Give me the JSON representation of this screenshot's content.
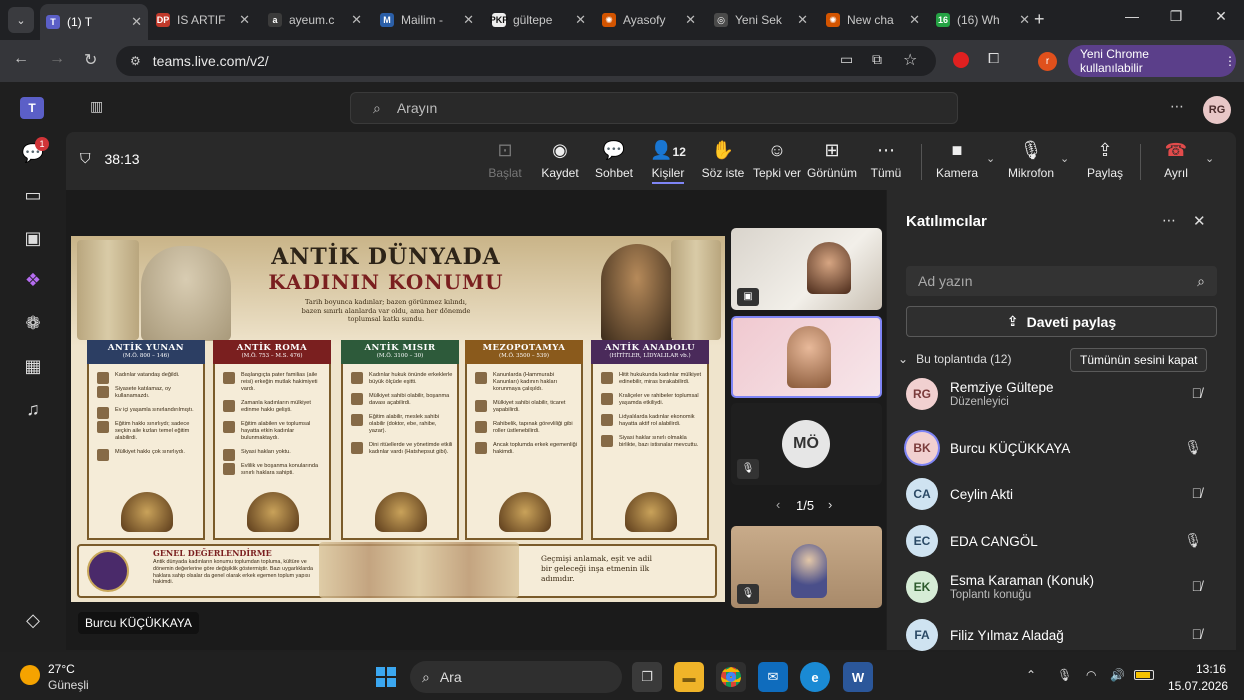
{
  "browser": {
    "tabs": [
      {
        "label": "(1) T",
        "color": "#5b5fc7",
        "glyph": "T"
      },
      {
        "label": "IS ARTIF",
        "color": "#c0392b",
        "glyph": "DP"
      },
      {
        "label": "ayeum.c",
        "color": "#3b3b3b",
        "glyph": "a"
      },
      {
        "label": "Mailim -",
        "color": "#2b5fa8",
        "glyph": "M"
      },
      {
        "label": "gültepe",
        "color": "#eeeeee",
        "glyph": "PKP"
      },
      {
        "label": "Ayasofy",
        "color": "#d35400",
        "glyph": "✺"
      },
      {
        "label": "Yeni Sek",
        "color": "#4a4a4a",
        "glyph": "◎"
      },
      {
        "label": "New cha",
        "color": "#d35400",
        "glyph": "✺"
      },
      {
        "label": "(16) Wh",
        "color": "#25a244",
        "glyph": "16"
      }
    ],
    "url": "teams.live.com/v2/",
    "profile_letter": "r",
    "profile_button": "Yeni Chrome kullanılabilir"
  },
  "teams": {
    "search_placeholder": "Arayın",
    "avatar": "RG",
    "chat_badge": "1",
    "timer": "38:13",
    "toolbar": {
      "start": "Başlat",
      "record": "Kaydet",
      "chat": "Sohbet",
      "people": "Kişiler",
      "people_count": "12",
      "raise": "Söz iste",
      "react": "Tepki ver",
      "view": "Görünüm",
      "more": "Tümü",
      "camera": "Kamera",
      "mic": "Mikrofon",
      "share": "Paylaş",
      "leave": "Ayrıl"
    },
    "presenter_label": "Burcu KÜÇÜKKAYA",
    "video": {
      "mo_initials": "MÖ",
      "pager": "1/5"
    },
    "participants": {
      "title": "Katılımcılar",
      "search_placeholder": "Ad yazın",
      "invite": "Daveti paylaş",
      "section": "Bu toplantıda (12)",
      "mute_all": "Tümünün sesini kapat",
      "people": [
        {
          "initials": "RG",
          "name": "Remziye Gültepe",
          "sub": "Düzenleyici",
          "bg": "#f1d0d0",
          "fg": "#7a3b3b",
          "mic": "muted"
        },
        {
          "initials": "BK",
          "name": "Burcu KÜÇÜKKAYA",
          "sub": "",
          "bg": "#f1d0d0",
          "fg": "#7a3b3b",
          "mic": "on"
        },
        {
          "initials": "CA",
          "name": "Ceylin Akti",
          "sub": "",
          "bg": "#cfe3f1",
          "fg": "#2b4a66",
          "mic": "muted"
        },
        {
          "initials": "EC",
          "name": "EDA CANGÖL",
          "sub": "",
          "bg": "#cfe3f1",
          "fg": "#2b4a66",
          "mic": "on"
        },
        {
          "initials": "EK",
          "name": "Esma Karaman (Konuk)",
          "sub": "Toplantı konuğu",
          "bg": "#d6ecd6",
          "fg": "#2d5a2d",
          "mic": "muted"
        },
        {
          "initials": "FA",
          "name": "Filiz Yılmaz Aladağ",
          "sub": "",
          "bg": "#cfe3f1",
          "fg": "#2b4a66",
          "mic": "muted"
        }
      ]
    }
  },
  "slide": {
    "title1": "ANTİK DÜNYADA",
    "title2": "KADININ KONUMU",
    "subtitle": "Tarih boyunca kadınlar; bazen görünmez kılındı, bazen sınırlı alanlarda var oldu, ama her dönemde toplumsal katkı sundu.",
    "columns": [
      {
        "title": "ANTİK YUNAN",
        "era": "(M.Ö. 800 – 146)",
        "color": "#2c3e63",
        "items": [
          "Kadınlar vatandaş değildi.",
          "Siyasete katılamaz, oy kullanamazdı.",
          "Ev içi yaşamla sınırlandırılmıştı.",
          "Eğitim hakkı sınırlıydı; sadece seçkin aile kızları temel eğitim alabilirdi.",
          "Mülkiyet hakkı çok sınırlıydı."
        ]
      },
      {
        "title": "ANTİK ROMA",
        "era": "(M.Ö. 753 – M.S. 476)",
        "color": "#7a1f1f",
        "items": [
          "Başlangıçta pater familias (aile reisi) erkeğin mutlak hakimiyeti vardı.",
          "Zamanla kadınların mülkiyet edinme hakkı gelişti.",
          "Eğitim alabilen ve toplumsal hayatta etkin kadınlar bulunmaktaydı.",
          "Siyasi hakları yoktu.",
          "Evlilik ve boşanma konularında sınırlı haklara sahipti."
        ]
      },
      {
        "title": "ANTİK MISIR",
        "era": "(M.Ö. 3100 – 30)",
        "color": "#2d5a3a",
        "items": [
          "Kadınlar hukuk önünde erkeklerle büyük ölçüde eşitti.",
          "Mülkiyet sahibi olabilir, boşanma davası açabilirdi.",
          "Eğitim alabilir, meslek sahibi olabilir (doktor, ebe, rahibe, yazar).",
          "Dini ritüellerde ve yönetimde etkili kadınlar vardı (Hatshepsut gibi)."
        ]
      },
      {
        "title": "MEZOPOTAMYA",
        "era": "(M.Ö. 3500 – 539)",
        "color": "#8a5a1c",
        "items": [
          "Kanunlarda (Hammurabi Kanunları) kadının hakları korunmaya çalışıldı.",
          "Mülkiyet sahibi olabilir, ticaret yapabilirdi.",
          "Rahibelik, tapınak görevliliği gibi roller üstlenebilirdi.",
          "Ancak toplumda erkek egemenliği hakimdi."
        ]
      },
      {
        "title": "ANTİK ANADOLU",
        "era": "(HİTİTLER, LİDYALILAR vb.)",
        "color": "#4a2a5a",
        "items": [
          "Hitit hukukunda kadınlar mülkiyet edinebilir, miras bırakabilirdi.",
          "Kraliçeler ve rahibeler toplumsal yaşamda etkiliydi.",
          "Lidyalılarda kadınlar ekonomik hayatta aktif rol alabilirdi.",
          "Siyasi haklar sınırlı olmakla birlikte, bazı istisnalar mevcuttu."
        ]
      }
    ],
    "general_title": "GENEL DEĞERLENDİRME",
    "general_text": "Antik dünyada kadınların konumu toplumdan topluma, kültüre ve dönemin değerlerine göre değişiklik göstermiştir. Bazı uygarlıklarda haklara sahip olsalar da genel olarak erkek egemen toplum yapısı hakimdi.",
    "quote": "Geçmişi anlamak, eşit ve adil bir geleceği inşa etmenin ilk adımıdır."
  },
  "taskbar": {
    "temp": "27°C",
    "weather": "Güneşli",
    "search": "Ara",
    "time": "13:16",
    "date": "15.07.2026"
  }
}
